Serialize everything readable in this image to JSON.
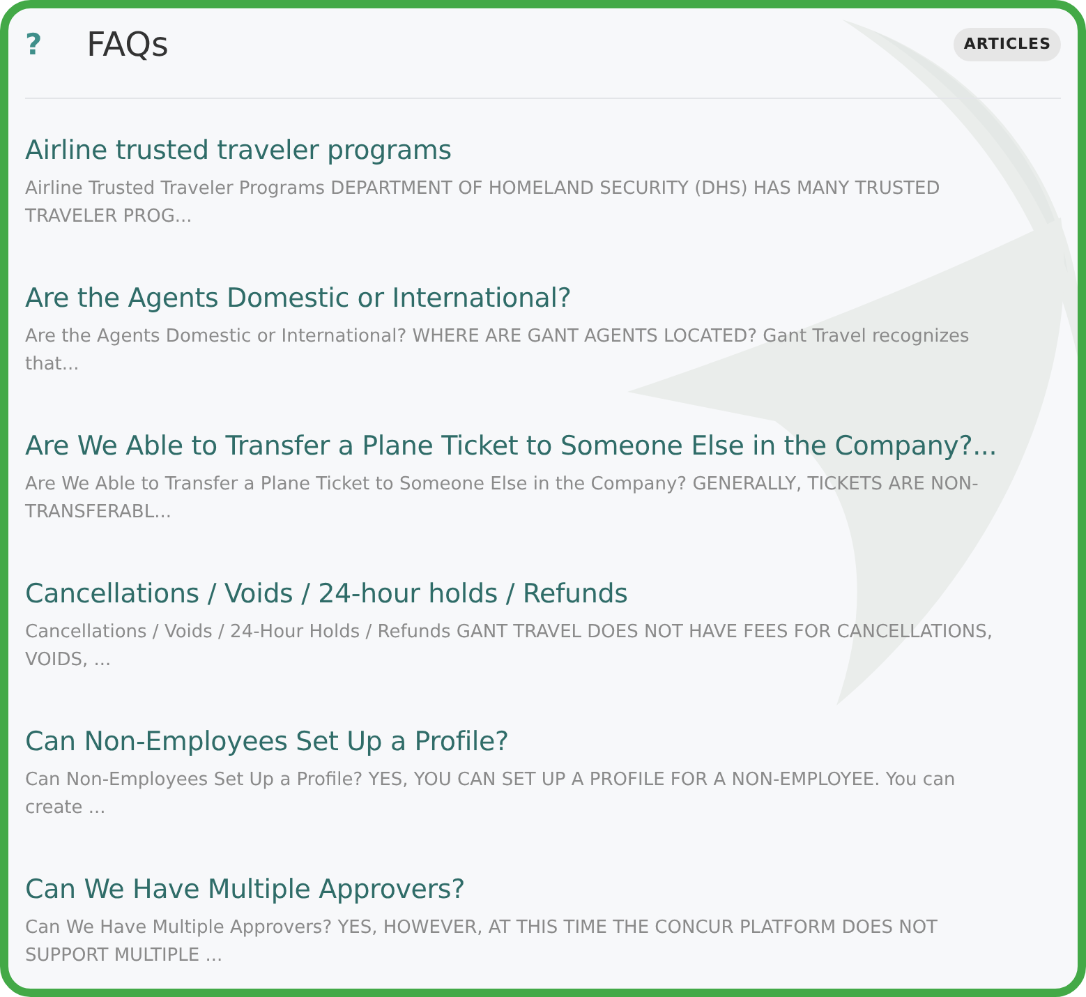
{
  "header": {
    "icon": "?",
    "title": "FAQs",
    "badge": "ARTICLES"
  },
  "articles": [
    {
      "title": "Airline trusted traveler programs",
      "excerpt": "Airline Trusted Traveler Programs DEPARTMENT OF HOMELAND SECURITY (DHS) HAS MANY TRUSTED TRAVELER PROG..."
    },
    {
      "title": "Are the Agents Domestic or International?",
      "excerpt": "Are the Agents Domestic or International? WHERE ARE GANT AGENTS LOCATED? Gant Travel recognizes that..."
    },
    {
      "title": "Are We Able to Transfer a Plane Ticket to Someone Else in the Company?...",
      "excerpt": "Are We Able to Transfer a Plane Ticket to Someone Else in the Company? GENERALLY, TICKETS ARE NON-TRANSFERABL..."
    },
    {
      "title": "Cancellations / Voids / 24-hour holds / Refunds",
      "excerpt": "Cancellations / Voids / 24-Hour Holds / Refunds GANT TRAVEL DOES NOT HAVE FEES FOR CANCELLATIONS, VOIDS, ..."
    },
    {
      "title": "Can Non-Employees Set Up a Profile?",
      "excerpt": "Can Non-Employees Set Up a Profile? YES, YOU CAN SET UP A PROFILE FOR A NON-EMPLOYEE. You can create ..."
    },
    {
      "title": "Can We Have Multiple Approvers?",
      "excerpt": "Can We Have Multiple Approvers? YES, HOWEVER, AT THIS TIME THE CONCUR PLATFORM DOES NOT SUPPORT MULTIPLE ..."
    }
  ]
}
